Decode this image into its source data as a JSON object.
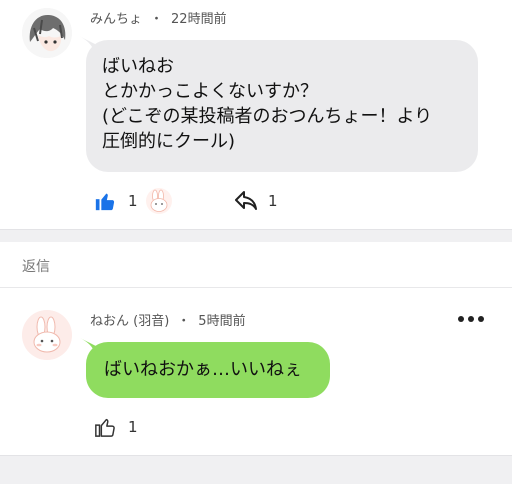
{
  "comment": {
    "author": "みんちょ",
    "separator": "・",
    "time": "22時間前",
    "lines": [
      "ばいねお",
      "とかかっこよくないすか？",
      "(どこぞの某投稿者のおつんちょー！より",
      "圧倒的にクール)"
    ],
    "like_count": "1",
    "reply_count": "1"
  },
  "replies_section": {
    "label": "返信"
  },
  "reply": {
    "author": "ねおん (羽音)",
    "separator": "・",
    "time": "5時間前",
    "text": "ばいねおかぁ…いいねぇ",
    "like_count": "1"
  },
  "colors": {
    "like_active": "#1a73e8",
    "reply_bubble": "#8fdc5f",
    "comment_bubble": "#ebebed"
  },
  "icons": [
    "avatar-anime-boy",
    "thumbs-up-icon",
    "bunny-reaction-icon",
    "reply-arrow-icon",
    "more-options-icon",
    "thumbs-up-outline-icon"
  ]
}
